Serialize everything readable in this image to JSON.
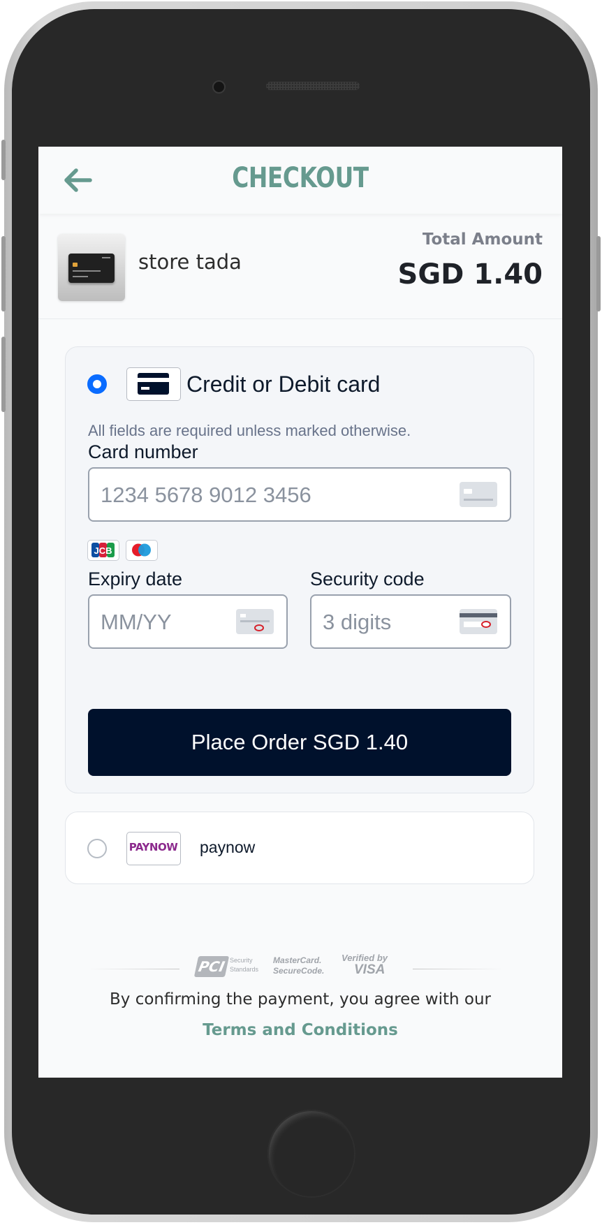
{
  "header": {
    "title": "CHECKOUT",
    "back_icon": "arrow-left-icon"
  },
  "merchant": {
    "store_name": "store tada",
    "total_label": "Total Amount",
    "total_amount": "SGD 1.40"
  },
  "payment_methods": {
    "card": {
      "label": "Credit or Debit card",
      "selected": true,
      "hint": "All fields are required unless marked otherwise.",
      "card_number": {
        "label": "Card number",
        "placeholder": "1234 5678 9012 3456"
      },
      "brands": [
        "JCB",
        "Maestro"
      ],
      "expiry": {
        "label": "Expiry date",
        "placeholder": "MM/YY"
      },
      "cvc": {
        "label": "Security code",
        "placeholder": "3 digits"
      },
      "submit_label": "Place Order SGD 1.40"
    },
    "paynow": {
      "label": "paynow",
      "logo_text": "PAYNOW",
      "selected": false
    }
  },
  "trust_badges": {
    "pci": {
      "logo": "PCI",
      "line1": "Security",
      "line2": "Standards"
    },
    "mastercard": {
      "line1": "MasterCard.",
      "line2": "SecureCode."
    },
    "visa": {
      "line1": "Verified by",
      "line2": "VISA"
    }
  },
  "footer": {
    "agree_text": "By confirming the payment, you agree with our",
    "terms_label": "Terms and Conditions"
  },
  "colors": {
    "accent": "#669a8f",
    "primary_button": "#00112c",
    "radio_selected": "#0a6cff"
  }
}
